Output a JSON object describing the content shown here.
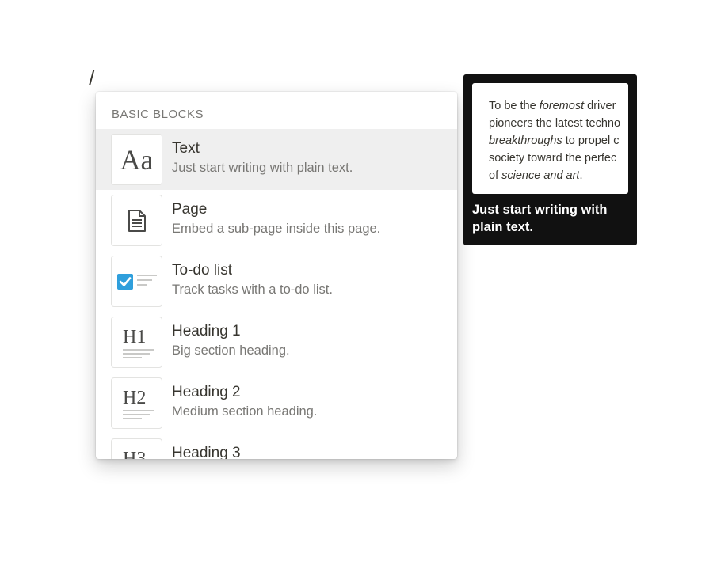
{
  "editor": {
    "slash_char": "/"
  },
  "menu": {
    "section_title": "BASIC BLOCKS",
    "items": [
      {
        "label": "Text",
        "description": "Just start writing with plain text.",
        "thumb": "Aa"
      },
      {
        "label": "Page",
        "description": "Embed a sub-page inside this page."
      },
      {
        "label": "To-do list",
        "description": "Track tasks with a to-do list."
      },
      {
        "label": "Heading 1",
        "description": "Big section heading.",
        "thumb": "H1"
      },
      {
        "label": "Heading 2",
        "description": "Medium section heading.",
        "thumb": "H2"
      },
      {
        "label": "Heading 3",
        "thumb": "H3"
      }
    ]
  },
  "preview": {
    "lines": [
      {
        "a": "To be the ",
        "b": "foremost",
        "c": " driver"
      },
      {
        "a": "pioneers the latest techno",
        "b": "",
        "c": ""
      },
      {
        "a": "",
        "b": "breakthroughs",
        "c": " to propel c"
      },
      {
        "a": "society toward the perfec",
        "b": "",
        "c": ""
      },
      {
        "a": "of ",
        "b": "science and art",
        "c": "."
      }
    ],
    "caption": "Just start writing with plain text."
  },
  "colors": {
    "checkbox": "#2f9fdc",
    "active_row": "#efefef",
    "preview_bg": "#111111"
  },
  "icons": [
    "page-icon",
    "checkbox-icon"
  ]
}
